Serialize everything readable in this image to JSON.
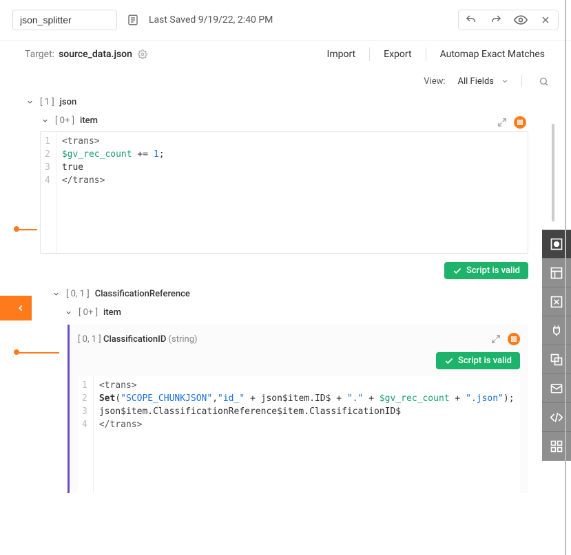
{
  "header": {
    "name": "json_splitter",
    "last_saved": "Last Saved 9/19/22, 2:40 PM"
  },
  "secondary": {
    "target_label": "Target:",
    "target_value": "source_data.json",
    "import": "Import",
    "export": "Export",
    "automap": "Automap Exact Matches"
  },
  "view": {
    "label": "View:",
    "selected": "All Fields"
  },
  "tree": {
    "json": {
      "card": "[ 1 ]",
      "name": "json"
    },
    "item1": {
      "card": "[ 0+ ]",
      "name": "item"
    },
    "class_ref": {
      "card": "[ 0, 1 ]",
      "name": "ClassificationReference"
    },
    "item2": {
      "card": "[ 0+ ]",
      "name": "item"
    },
    "class_id": {
      "card": "[ 0, 1 ]",
      "name": "ClassificationID",
      "type": "(string)"
    }
  },
  "badges": {
    "valid": "Script is valid"
  },
  "code1": {
    "l1": "<trans>",
    "l2a": "$gv_rec_count",
    "l2b": " += ",
    "l2c": "1",
    "l2d": ";",
    "l3": "true",
    "l4": "</trans>"
  },
  "code2": {
    "l1": "<trans>",
    "l2_fn": "Set",
    "l2_p": "(",
    "l2_s1": "\"SCOPE_CHUNKJSON\"",
    "l2_c1": ",",
    "l2_s2": "\"id_\"",
    "l2_op1": " + ",
    "l2_v1": "json$item.ID$",
    "l2_op2": " + ",
    "l2_s3": "\".\"",
    "l2_op3": " + ",
    "l2_v2": "$gv_rec_count",
    "l2_op4": " + ",
    "l2_s4": "\".json\"",
    "l2_pe": ");",
    "l3": "json$item.ClassificationReference$item.ClassificationID$",
    "l4": "</trans>"
  }
}
